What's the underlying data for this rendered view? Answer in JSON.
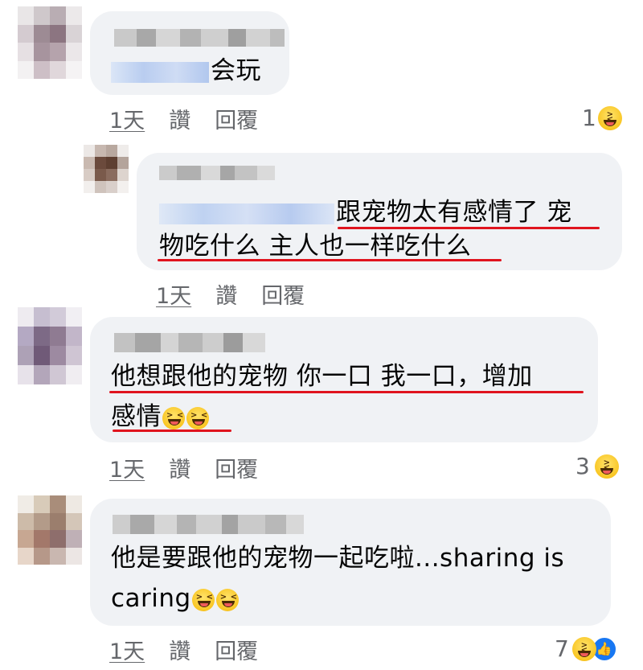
{
  "comments": [
    {
      "text_lines": [
        "会玩"
      ],
      "time": "1天",
      "like_label": "讚",
      "reply_label": "回覆",
      "reaction_count": "1",
      "reaction_icon": "haha-icon"
    },
    {
      "text_lines": [
        "跟宠物太有感情了 宠",
        "物吃什么 主人也一样吃什么"
      ],
      "time": "1天",
      "like_label": "讚",
      "reply_label": "回覆"
    },
    {
      "text_lines": [
        "他想跟他的宠物 你一口 我一口，增加",
        "感情"
      ],
      "time": "1天",
      "like_label": "讚",
      "reply_label": "回覆",
      "reaction_count": "3",
      "reaction_icon": "haha-icon"
    },
    {
      "text_lines": [
        "他是要跟他的宠物一起吃啦...sharing is",
        "caring"
      ],
      "time": "1天",
      "like_label": "讚",
      "reply_label": "回覆",
      "reaction_count": "7",
      "reaction_icons": [
        "haha-icon",
        "like-icon"
      ]
    }
  ],
  "colors": {
    "bubble": "#f0f2f5",
    "meta_text": "#65676b",
    "highlight_underline": "#e0141e",
    "like_blue": "#1877f2"
  }
}
